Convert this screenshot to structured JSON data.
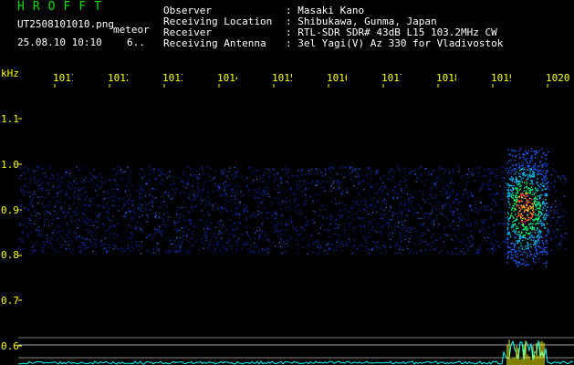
{
  "header": {
    "brand": "HROFFT",
    "filename": "UT2508101010.png",
    "tag": "meteor",
    "timestamp": "25.08.10 10:10",
    "count": "6..",
    "info_labels": [
      "Observer",
      "Receiving Location",
      "Receiver",
      "Receiving Antenna"
    ],
    "info_values": [
      ": Masaki Kano",
      ": Shibukawa, Gunma, Japan",
      ": RTL-SDR SDR# 43dB L15 103.2MHz CW",
      ": 3el Yagi(V) Az 330 for Vladivostok"
    ]
  },
  "spectrogram": {
    "freq_unit": "kHz",
    "freq_ticks": [
      "1.1",
      "1.0",
      "0.9",
      "0.8",
      "0.7",
      "0.6"
    ],
    "time_ticks": [
      "1011",
      "1012",
      "1013",
      "1014",
      "1015",
      "1016",
      "1017",
      "1018",
      "1019",
      "1020"
    ],
    "colors": {
      "background": "#000000",
      "axis_text": "#ffff00",
      "noise": "#1040ff",
      "echo_hot": "#ff3030",
      "level": "#00ffff",
      "level_peak": "#ffff00"
    }
  }
}
